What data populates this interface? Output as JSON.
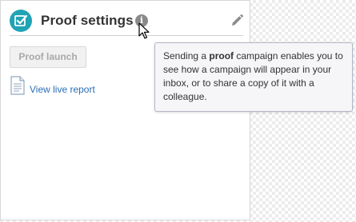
{
  "panel": {
    "title": "Proof settings",
    "launch_button": "Proof launch",
    "report_link": "View live report"
  },
  "tooltip": {
    "before": "Sending a ",
    "bold": "proof",
    "after": " campaign enables you to see how a campaign will appear in your inbox, or to share a copy of it with a colleague."
  },
  "icons": {
    "badge": "checkbox-check-icon",
    "info": "info-icon",
    "edit": "pencil-icon",
    "report": "document-icon",
    "cursor": "mouse-pointer-icon"
  },
  "colors": {
    "accent": "#1fa3b5",
    "link": "#2a6fb5",
    "info_icon": "#8a8a8a",
    "tooltip_bg": "#f6f6f8",
    "tooltip_border": "#b4b8c4"
  }
}
